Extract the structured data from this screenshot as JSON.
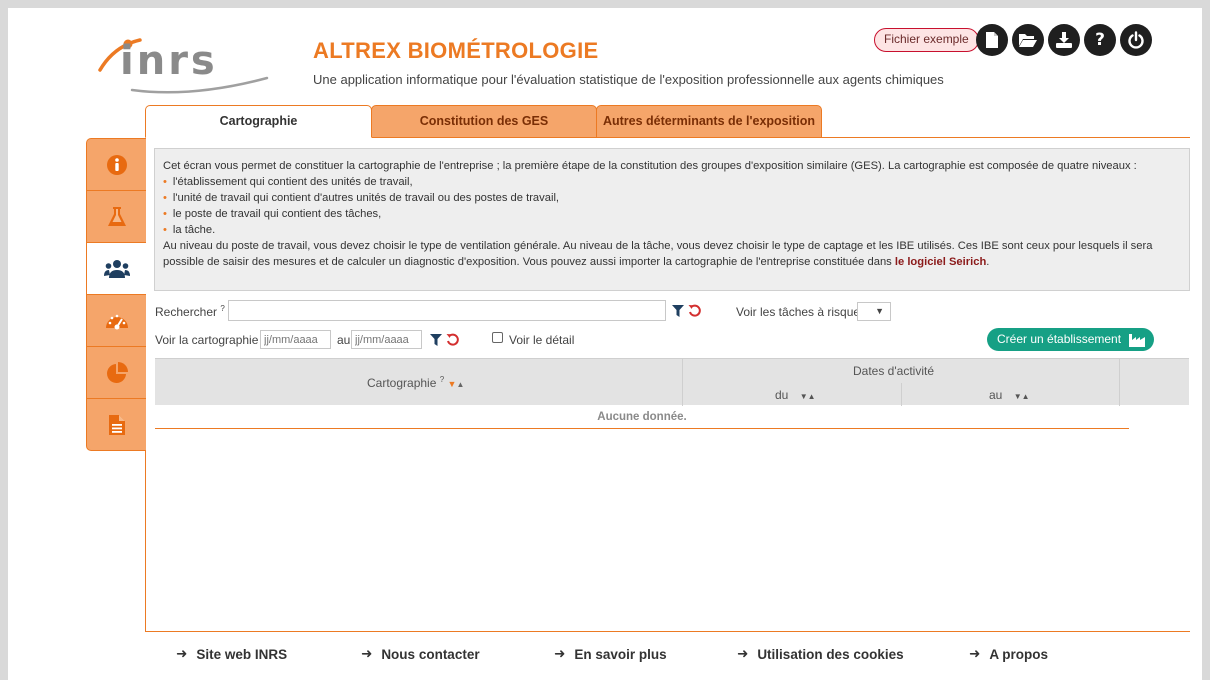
{
  "header": {
    "logo_text": "inrs",
    "title": "ALTREX BIOMÉTROLOGIE",
    "subtitle": "Une application informatique pour l'évaluation statistique de l'exposition professionnelle aux agents chimiques",
    "sample_button": "Fichier exemple",
    "icons": [
      "new-file-icon",
      "open-folder-icon",
      "download-icon",
      "help-icon",
      "power-icon"
    ]
  },
  "tabs": [
    {
      "label": "Cartographie",
      "active": true
    },
    {
      "label": "Constitution des GES",
      "active": false
    },
    {
      "label": "Autres déterminants de l'exposition",
      "active": false
    }
  ],
  "sidenav": {
    "icons": [
      "info-icon",
      "flask-icon",
      "users-icon",
      "gauge-icon",
      "pie-chart-icon",
      "document-icon"
    ],
    "active_index": 2
  },
  "info": {
    "intro": "Cet écran vous permet de constituer la cartographie de l'entreprise ; la première étape de la constitution des groupes d'exposition similaire (GES). La cartographie est composée de quatre niveaux :",
    "levels": [
      "l'établissement qui contient des unités de travail,",
      "l'unité de travail qui contient d'autres unités de travail ou des postes de travail,",
      "le poste de travail qui contient des tâches,",
      "la tâche."
    ],
    "detail": "Au niveau du poste de travail, vous devez choisir le type de ventilation générale. Au niveau de la tâche, vous devez choisir le type de captage et les IBE utilisés. Ces IBE sont ceux pour lesquels il sera possible de saisir des mesures et de calculer un diagnostic d'exposition. Vous pouvez aussi importer la cartographie de l'entreprise constituée dans ",
    "link": "le logiciel Seirich",
    "end": "."
  },
  "search": {
    "label": "Rechercher",
    "help_mark": "?",
    "colon": ":",
    "value": "",
    "risk_label": "Voir les tâches à risque",
    "risk_value": "",
    "map_label": "Voir la cartographie du",
    "date_placeholder": "jj/mm/aaaa",
    "to_label": "au",
    "detail_label": "Voir le détail",
    "detail_checked": false,
    "create_button": "Créer un établissement"
  },
  "table": {
    "columns": [
      "Cartographie"
    ],
    "group_header": "Dates d'activité",
    "sub_columns": [
      "du",
      "au"
    ],
    "empty_text": "Aucune donnée."
  },
  "footer": {
    "links": [
      "Site web INRS",
      "Nous contacter",
      "En savoir plus",
      "Utilisation des cookies",
      "A propos"
    ]
  },
  "colors": {
    "accent": "#ec7a23",
    "tab_inactive": "#f5a56a",
    "create_button": "#16a085",
    "link": "#8b1a1a"
  }
}
